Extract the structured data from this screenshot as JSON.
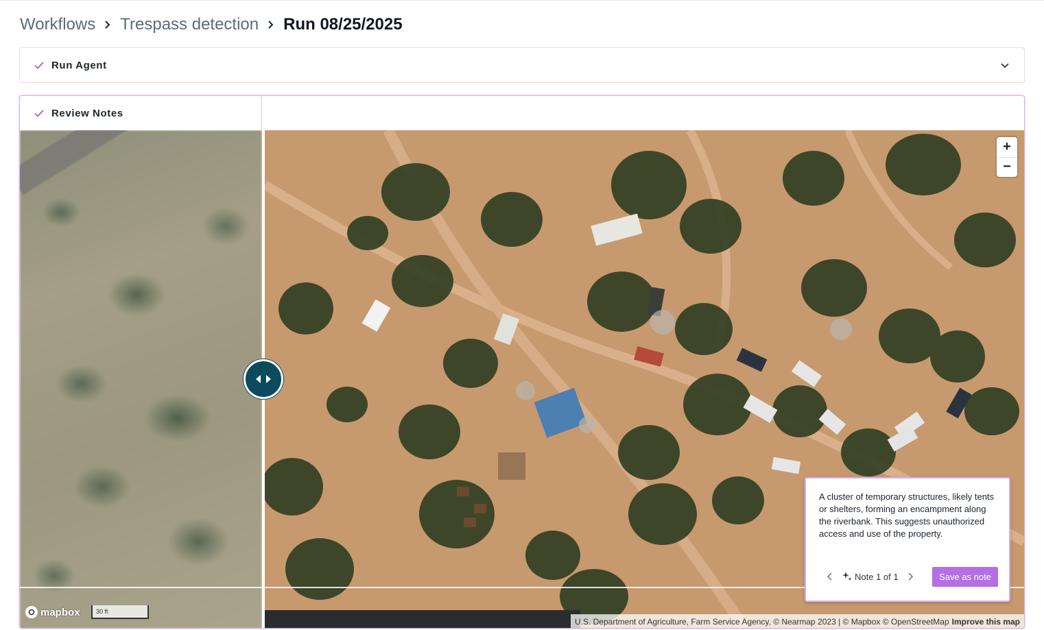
{
  "breadcrumb": {
    "items": [
      {
        "label": "Workflows"
      },
      {
        "label": "Trespass detection"
      }
    ],
    "current": "Run 08/25/2025"
  },
  "sections": {
    "run_agent": {
      "title": "Run Agent",
      "status": "complete"
    },
    "review_notes": {
      "title": "Review Notes",
      "status": "complete"
    }
  },
  "map": {
    "zoom_in_label": "+",
    "zoom_out_label": "−",
    "logo_text": "mapbox",
    "scale_label": "30 ft",
    "attribution": "U.S. Department of Agriculture, Farm Service Agency, © Nearmap 2023 | © Mapbox © OpenStreetMap",
    "attribution_link": "Improve this map"
  },
  "note": {
    "text": "A cluster of temporary structures, likely tents or shelters, forming an encampment along the riverbank. This suggests unauthorized access and use of the property.",
    "counter": "Note 1 of 1",
    "save_label": "Save as note"
  },
  "colors": {
    "accent": "#b56ee4",
    "handle": "#0c4a5e",
    "check": "#a45cd8"
  }
}
